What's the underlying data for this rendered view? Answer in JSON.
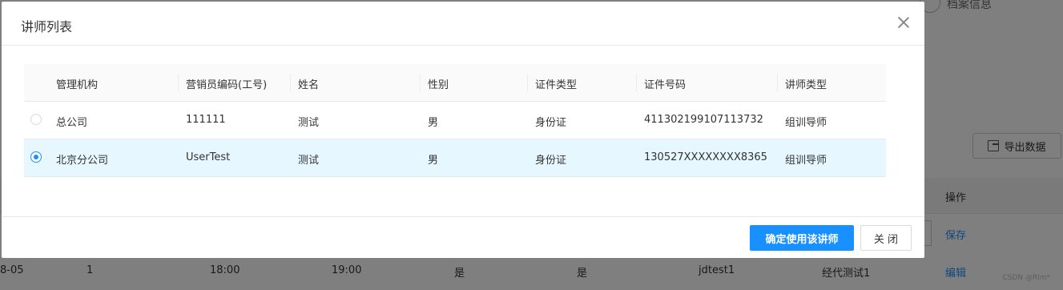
{
  "background": {
    "step_label": "档案信息",
    "export_button": "导出数据",
    "ops_header": "操作",
    "save_link": "保存",
    "row": {
      "date": "8-05",
      "num": "1",
      "start": "18:00",
      "end": "19:00",
      "flag1": "是",
      "flag2": "是",
      "account": "jdtest1",
      "name": "经代测试1",
      "edit": "编辑"
    },
    "watermark": "CSDN @Rlm*"
  },
  "modal": {
    "title": "讲师列表",
    "columns": [
      "管理机构",
      "营销员编码(工号)",
      "姓名",
      "性别",
      "证件类型",
      "证件号码",
      "讲师类型"
    ],
    "rows": [
      {
        "selected": false,
        "org": "总公司",
        "code": "111111",
        "name": "测试",
        "gender": "男",
        "id_type": "身份证",
        "id_no": "411302199107113732",
        "type": "组训导师"
      },
      {
        "selected": true,
        "org": "北京分公司",
        "code": "UserTest",
        "name": "测试",
        "gender": "男",
        "id_type": "身份证",
        "id_no": "130527XXXXXXXX8365",
        "type": "组训导师"
      }
    ],
    "confirm_button": "确定使用该讲师",
    "close_button": "关 闭"
  },
  "colors": {
    "primary": "#1890ff",
    "selected_row": "#e6f7ff"
  }
}
